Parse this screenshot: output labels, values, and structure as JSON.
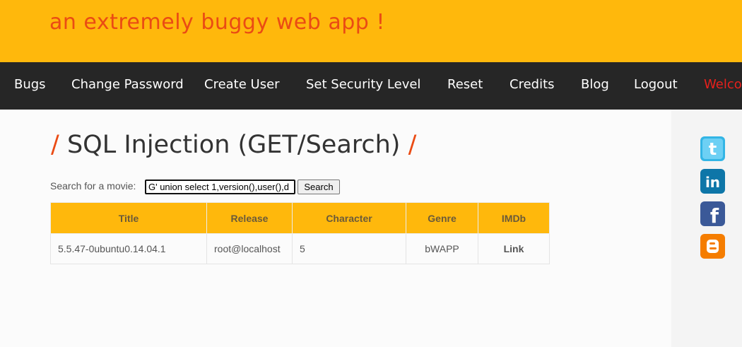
{
  "header": {
    "tagline": "an extremely buggy web app !"
  },
  "nav": {
    "items": [
      "Bugs",
      "Change Password",
      "Create User",
      "Set Security Level",
      "Reset",
      "Credits",
      "Blog",
      "Logout"
    ],
    "welcome": "Welcome"
  },
  "page": {
    "title_slash_left": "/",
    "title": "SQL Injection (GET/Search)",
    "title_slash_right": "/"
  },
  "search": {
    "label": "Search for a movie:",
    "value": "G' union select 1,version(),user(),d",
    "button_label": "Search"
  },
  "table": {
    "columns": [
      "Title",
      "Release",
      "Character",
      "Genre",
      "IMDb"
    ],
    "rows": [
      [
        "5.5.47-0ubuntu0.14.04.1",
        "root@localhost",
        "5",
        "bWAPP",
        "Link"
      ]
    ]
  },
  "social": [
    "twitter-icon",
    "linkedin-icon",
    "facebook-icon",
    "blogger-icon"
  ],
  "colors": {
    "header_bg": "#ffb80c",
    "accent": "#ea4b14",
    "nav_bg": "#262626",
    "welcome": "#e8201c"
  }
}
